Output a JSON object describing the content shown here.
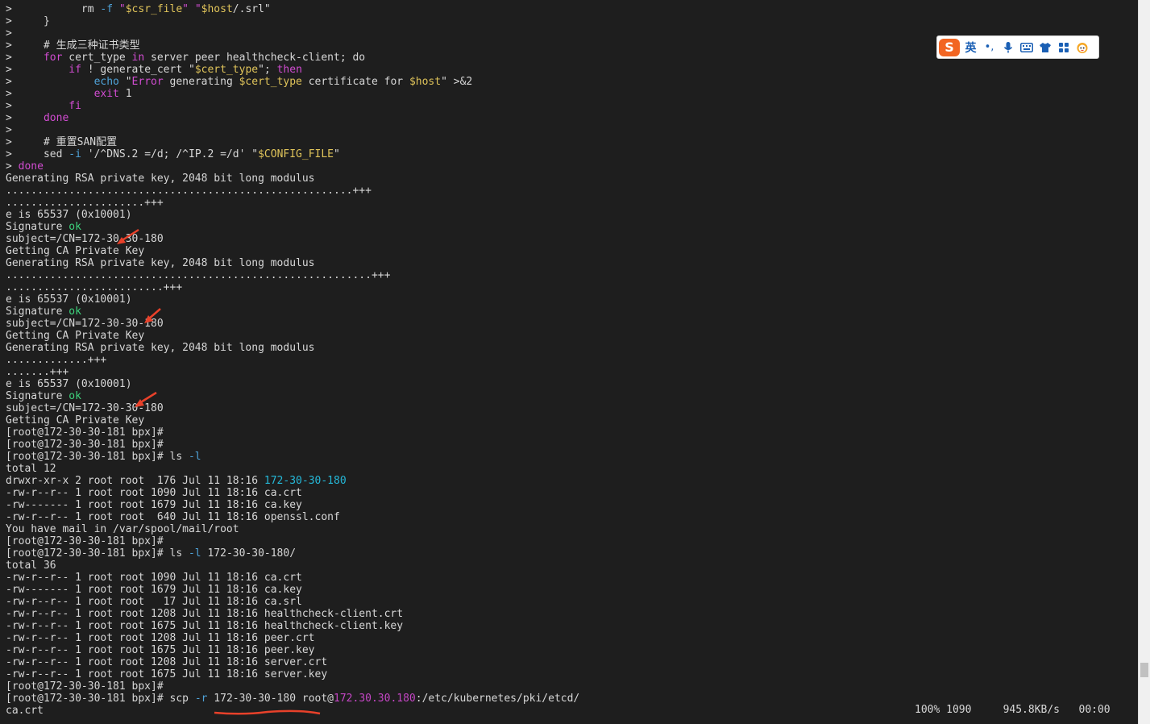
{
  "terminal": {
    "lines": [
      [
        {
          "t": "> ",
          "c": "wh"
        },
        {
          "t": "          rm ",
          "c": "wh"
        },
        {
          "t": "-f",
          "c": "opt"
        },
        {
          "t": " \"",
          "c": "str"
        },
        {
          "t": "$csr_file",
          "c": "var"
        },
        {
          "t": "\" \"",
          "c": "str"
        },
        {
          "t": "$host",
          "c": "var"
        },
        {
          "t": "/.srl\"",
          "c": "wh"
        }
      ],
      [
        {
          "t": ">     }",
          "c": "wh"
        }
      ],
      [
        {
          "t": ">",
          "c": "wh"
        }
      ],
      [
        {
          "t": ">     # 生成三种证书类型",
          "c": "cmt"
        }
      ],
      [
        {
          "t": ">     ",
          "c": "wh"
        },
        {
          "t": "for",
          "c": "kw"
        },
        {
          "t": " cert_type ",
          "c": "wh"
        },
        {
          "t": "in",
          "c": "kw"
        },
        {
          "t": " server peer healthcheck-client; do",
          "c": "wh"
        }
      ],
      [
        {
          "t": ">         ",
          "c": "wh"
        },
        {
          "t": "if",
          "c": "kw"
        },
        {
          "t": " ! generate_cert \"",
          "c": "wh"
        },
        {
          "t": "$cert_type",
          "c": "var"
        },
        {
          "t": "\"; ",
          "c": "wh"
        },
        {
          "t": "then",
          "c": "kw"
        }
      ],
      [
        {
          "t": ">             ",
          "c": "wh"
        },
        {
          "t": "echo",
          "c": "opt"
        },
        {
          "t": " \"",
          "c": "wh"
        },
        {
          "t": "Error",
          "c": "str"
        },
        {
          "t": " generating ",
          "c": "wh"
        },
        {
          "t": "$cert_type",
          "c": "var"
        },
        {
          "t": " certificate for ",
          "c": "wh"
        },
        {
          "t": "$host",
          "c": "var"
        },
        {
          "t": "\" >&2",
          "c": "wh"
        }
      ],
      [
        {
          "t": ">             ",
          "c": "wh"
        },
        {
          "t": "exit",
          "c": "kw"
        },
        {
          "t": " 1",
          "c": "wh"
        }
      ],
      [
        {
          "t": ">         ",
          "c": "wh"
        },
        {
          "t": "fi",
          "c": "kw"
        }
      ],
      [
        {
          "t": ">     ",
          "c": "wh"
        },
        {
          "t": "done",
          "c": "kw"
        }
      ],
      [
        {
          "t": ">",
          "c": "wh"
        }
      ],
      [
        {
          "t": ">     # 重置SAN配置",
          "c": "cmt"
        }
      ],
      [
        {
          "t": ">     sed ",
          "c": "wh"
        },
        {
          "t": "-i",
          "c": "opt"
        },
        {
          "t": " '/^DNS.2 =/d; /^IP.2 =/d' \"",
          "c": "wh"
        },
        {
          "t": "$CONFIG_FILE",
          "c": "var"
        },
        {
          "t": "\"",
          "c": "wh"
        }
      ],
      [
        {
          "t": "> ",
          "c": "wh"
        },
        {
          "t": "done",
          "c": "kw"
        }
      ],
      [
        {
          "t": "Generating RSA private key, 2048 bit long modulus",
          "c": "wh"
        }
      ],
      [
        {
          "t": ".......................................................+++",
          "c": "wh"
        }
      ],
      [
        {
          "t": "......................+++",
          "c": "wh"
        }
      ],
      [
        {
          "t": "e is 65537 (0x10001)",
          "c": "wh"
        }
      ],
      [
        {
          "t": "Signature ",
          "c": "wh"
        },
        {
          "t": "ok",
          "c": "grn"
        }
      ],
      [
        {
          "t": "subject=/CN=172-30-30-180",
          "c": "wh"
        }
      ],
      [
        {
          "t": "Getting CA Private Key",
          "c": "wh"
        }
      ],
      [
        {
          "t": "Generating RSA private key, 2048 bit long modulus",
          "c": "wh"
        }
      ],
      [
        {
          "t": "..........................................................+++",
          "c": "wh"
        }
      ],
      [
        {
          "t": ".........................+++",
          "c": "wh"
        }
      ],
      [
        {
          "t": "e is 65537 (0x10001)",
          "c": "wh"
        }
      ],
      [
        {
          "t": "Signature ",
          "c": "wh"
        },
        {
          "t": "ok",
          "c": "grn"
        }
      ],
      [
        {
          "t": "subject=/CN=172-30-30-180",
          "c": "wh"
        }
      ],
      [
        {
          "t": "Getting CA Private Key",
          "c": "wh"
        }
      ],
      [
        {
          "t": "Generating RSA private key, 2048 bit long modulus",
          "c": "wh"
        }
      ],
      [
        {
          "t": ".............+++",
          "c": "wh"
        }
      ],
      [
        {
          "t": ".......+++",
          "c": "wh"
        }
      ],
      [
        {
          "t": "e is 65537 (0x10001)",
          "c": "wh"
        }
      ],
      [
        {
          "t": "Signature ",
          "c": "wh"
        },
        {
          "t": "ok",
          "c": "grn"
        }
      ],
      [
        {
          "t": "subject=/CN=172-30-30-180",
          "c": "wh"
        }
      ],
      [
        {
          "t": "Getting CA Private Key",
          "c": "wh"
        }
      ],
      [
        {
          "t": "[root@172-30-30-181 bpx]#",
          "c": "wh"
        }
      ],
      [
        {
          "t": "[root@172-30-30-181 bpx]#",
          "c": "wh"
        }
      ],
      [
        {
          "t": "[root@172-30-30-181 bpx]# ls ",
          "c": "wh"
        },
        {
          "t": "-l",
          "c": "opt"
        }
      ],
      [
        {
          "t": "total 12",
          "c": "wh"
        }
      ],
      [
        {
          "t": "drwxr-xr-x 2 root root  176 Jul 11 18:16 ",
          "c": "wh"
        },
        {
          "t": "172-30-30-180",
          "c": "cyan"
        }
      ],
      [
        {
          "t": "-rw-r--r-- 1 root root 1090 Jul 11 18:16 ca.crt",
          "c": "wh"
        }
      ],
      [
        {
          "t": "-rw------- 1 root root 1679 Jul 11 18:16 ca.key",
          "c": "wh"
        }
      ],
      [
        {
          "t": "-rw-r--r-- 1 root root  640 Jul 11 18:16 openssl.conf",
          "c": "wh"
        }
      ],
      [
        {
          "t": "You have mail in /var/spool/mail/root",
          "c": "wh"
        }
      ],
      [
        {
          "t": "[root@172-30-30-181 bpx]#",
          "c": "wh"
        }
      ],
      [
        {
          "t": "[root@172-30-30-181 bpx]# ls ",
          "c": "wh"
        },
        {
          "t": "-l",
          "c": "opt"
        },
        {
          "t": " 172-30-30-180/",
          "c": "wh"
        }
      ],
      [
        {
          "t": "total 36",
          "c": "wh"
        }
      ],
      [
        {
          "t": "-rw-r--r-- 1 root root 1090 Jul 11 18:16 ca.crt",
          "c": "wh"
        }
      ],
      [
        {
          "t": "-rw------- 1 root root 1679 Jul 11 18:16 ca.key",
          "c": "wh"
        }
      ],
      [
        {
          "t": "-rw-r--r-- 1 root root   17 Jul 11 18:16 ca.srl",
          "c": "wh"
        }
      ],
      [
        {
          "t": "-rw-r--r-- 1 root root 1208 Jul 11 18:16 healthcheck-client.crt",
          "c": "wh"
        }
      ],
      [
        {
          "t": "-rw-r--r-- 1 root root 1675 Jul 11 18:16 healthcheck-client.key",
          "c": "wh"
        }
      ],
      [
        {
          "t": "-rw-r--r-- 1 root root 1208 Jul 11 18:16 peer.crt",
          "c": "wh"
        }
      ],
      [
        {
          "t": "-rw-r--r-- 1 root root 1675 Jul 11 18:16 peer.key",
          "c": "wh"
        }
      ],
      [
        {
          "t": "-rw-r--r-- 1 root root 1208 Jul 11 18:16 server.crt",
          "c": "wh"
        }
      ],
      [
        {
          "t": "-rw-r--r-- 1 root root 1675 Jul 11 18:16 server.key",
          "c": "wh"
        }
      ],
      [
        {
          "t": "[root@172-30-30-181 bpx]#",
          "c": "wh"
        }
      ],
      [
        {
          "t": "[root@172-30-30-181 bpx]# scp ",
          "c": "wh"
        },
        {
          "t": "-r",
          "c": "opt"
        },
        {
          "t": " 172-30-30-180 root@",
          "c": "wh"
        },
        {
          "t": "172.30.30.180",
          "c": "ip"
        },
        {
          "t": ":/etc/kubernetes/pki/etcd/",
          "c": "wh"
        }
      ],
      [
        {
          "t": "ca.crt",
          "c": "wh"
        }
      ]
    ],
    "progress": "100% 1090     945.8KB/s   00:00"
  },
  "ime_toolbar": {
    "logo": "S",
    "lang": "英",
    "punct": "•,",
    "items": [
      "mic-icon",
      "keyboard-icon",
      "skin-icon",
      "toolbox-icon",
      "mascot-icon"
    ]
  },
  "colors": {
    "background": "#1e1e1e",
    "text": "#d7d7d7",
    "keyword": "#d14cd1",
    "variable": "#e0c45a",
    "option": "#4fa3d9",
    "ok": "#3dd37c",
    "directory": "#25b8d8",
    "annotation": "#e8412a"
  }
}
